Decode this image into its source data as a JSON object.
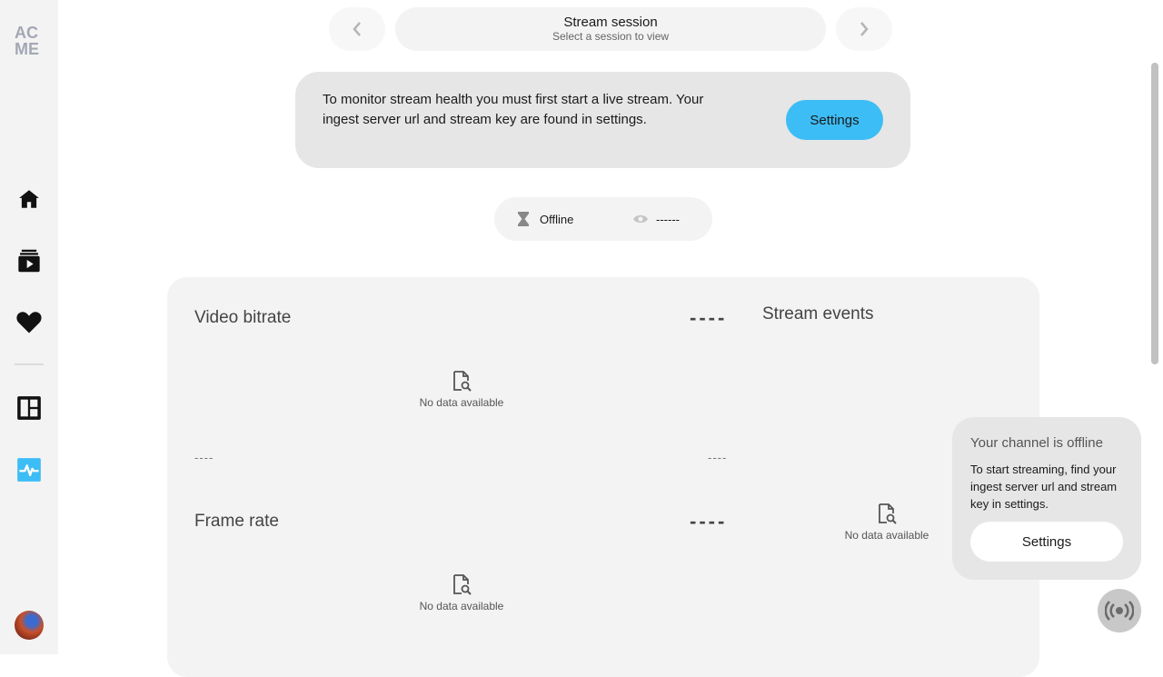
{
  "logo": {
    "line1": "AC",
    "line2": "ME"
  },
  "sidebar": {
    "items": [
      {
        "icon": "home-icon"
      },
      {
        "icon": "video-library-icon"
      },
      {
        "icon": "heart-icon"
      },
      {
        "icon": "dashboard-icon"
      },
      {
        "icon": "stream-health-icon",
        "active": true
      }
    ]
  },
  "session": {
    "title": "Stream session",
    "subtitle": "Select a session to view"
  },
  "banner": {
    "text": "To monitor stream health you must first start a live stream. Your ingest server url and stream key are found in settings.",
    "button": "Settings"
  },
  "status": {
    "state": "Offline",
    "viewers": "------"
  },
  "metrics": {
    "video_bitrate": {
      "title": "Video bitrate",
      "value": "----",
      "empty": "No data available",
      "axis_left": "----",
      "axis_right": "----"
    },
    "frame_rate": {
      "title": "Frame rate",
      "value": "----",
      "empty": "No data available"
    }
  },
  "events": {
    "title": "Stream events",
    "empty": "No data available"
  },
  "popup": {
    "title": "Your channel is offline",
    "text": "To start streaming, find your ingest server url and stream key in settings.",
    "button": "Settings"
  },
  "colors": {
    "accent": "#3dbdf5",
    "sidebar_bg": "#f3f3f3",
    "card_bg": "#f3f3f3",
    "banner_bg": "#e6e6e6"
  }
}
